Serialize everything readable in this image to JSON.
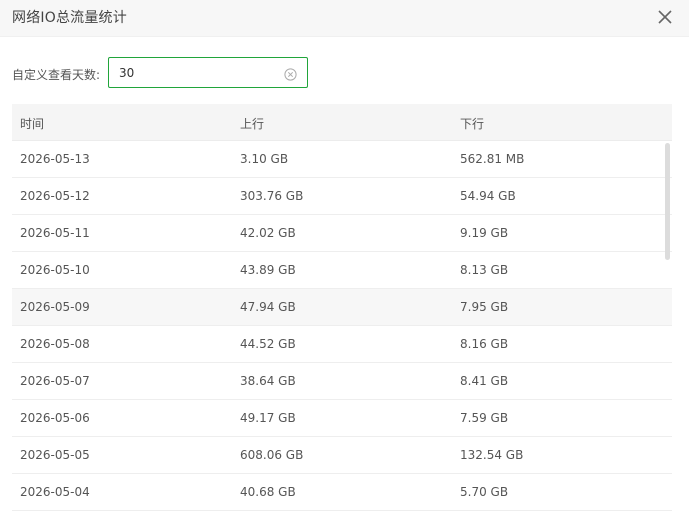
{
  "dialog": {
    "title": "网络IO总流量统计",
    "close_icon": "close-icon"
  },
  "filter": {
    "label": "自定义查看天数:",
    "days_value": "30",
    "clear_icon": "clear-circle-icon"
  },
  "table": {
    "headers": [
      "时间",
      "上行",
      "下行"
    ],
    "rows": [
      [
        "2026-05-13",
        "3.10 GB",
        "562.81 MB"
      ],
      [
        "2026-05-12",
        "303.76 GB",
        "54.94 GB"
      ],
      [
        "2026-05-11",
        "42.02 GB",
        "9.19 GB"
      ],
      [
        "2026-05-10",
        "43.89 GB",
        "8.13 GB"
      ],
      [
        "2026-05-09",
        "47.94 GB",
        "7.95 GB"
      ],
      [
        "2026-05-08",
        "44.52 GB",
        "8.16 GB"
      ],
      [
        "2026-05-07",
        "38.64 GB",
        "8.41 GB"
      ],
      [
        "2026-05-06",
        "49.17 GB",
        "7.59 GB"
      ],
      [
        "2026-05-05",
        "608.06 GB",
        "132.54 GB"
      ],
      [
        "2026-05-04",
        "40.68 GB",
        "5.70 GB"
      ]
    ]
  },
  "colors": {
    "accent": "#20a53a",
    "header_bg": "#f7f7f7",
    "table_head_bg": "#f5f5f5",
    "row_hover_bg": "#f7f7f7"
  }
}
